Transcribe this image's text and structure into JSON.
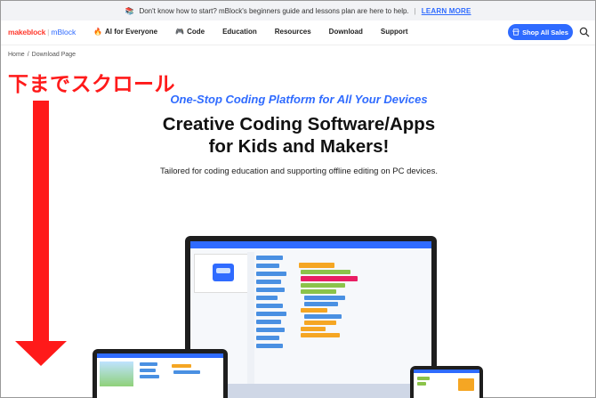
{
  "announcement": {
    "emoji": "📚",
    "text": "Don't know how to start? mBlock's beginners guide and lessons plan are here to help.",
    "separator": "|",
    "link": "LEARN MORE"
  },
  "nav": {
    "logo_brand": "makeblock",
    "logo_sep": "|",
    "logo_product": "mBlock",
    "items": [
      {
        "icon": "🔥",
        "label": "AI for Everyone"
      },
      {
        "icon": "🎮",
        "label": "Code"
      },
      {
        "icon": "",
        "label": "Education"
      },
      {
        "icon": "",
        "label": "Resources"
      },
      {
        "icon": "",
        "label": "Download"
      },
      {
        "icon": "",
        "label": "Support"
      }
    ],
    "shop_button": "Shop All Sales"
  },
  "breadcrumb": {
    "home": "Home",
    "sep": "/",
    "current": "Download Page"
  },
  "annotation": {
    "text": "下までスクロール",
    "color": "#ff1a1a"
  },
  "hero": {
    "subtitle": "One-Stop Coding Platform for All Your Devices",
    "title_line1": "Creative Coding Software/Apps",
    "title_line2": "for Kids and Makers!",
    "description": "Tailored for coding education and supporting offline editing on PC devices."
  },
  "colors": {
    "accent": "#2f6bff",
    "brand_red": "#ff3b2f",
    "block_orange": "#f5a623",
    "block_blue": "#4a90e2"
  }
}
